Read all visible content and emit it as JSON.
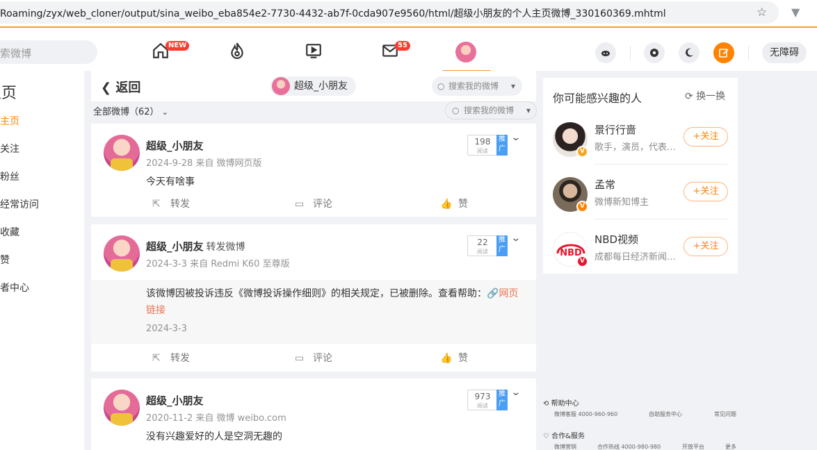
{
  "browser": {
    "url": "Roaming/zyx/web_cloner/output/sina_weibo_eba854e2-7730-4432-ab7f-0cda907e9560/html/超级小朋友的个人主页微博_330160369.mhtml"
  },
  "nav": {
    "search_placeholder": "索微博",
    "home_badge": "NEW",
    "message_badge": "55",
    "accessibility_label": "无障碍"
  },
  "sidebar": {
    "title": "主页",
    "items": [
      {
        "label": "的主页"
      },
      {
        "label": "的关注"
      },
      {
        "label": "的粉丝"
      },
      {
        "label": "的经常访问"
      },
      {
        "label": "的收藏"
      },
      {
        "label": "的赞"
      },
      {
        "label": "作者中心"
      }
    ]
  },
  "header": {
    "back_label": "返回",
    "user_chip": "超级_小朋友",
    "search_placeholder": "搜索我的微博"
  },
  "filter": {
    "all_label": "全部微博（62）",
    "search_placeholder": "搜索我的微博"
  },
  "posts": [
    {
      "author": "超级_小朋友",
      "repost_tag": "",
      "meta": "2024-9-28  来自 微博网页版",
      "text": "今天有啥事",
      "views": "198",
      "views_label": "阅读",
      "promo": "推广"
    },
    {
      "author": "超级_小朋友",
      "repost_tag": "转发微博",
      "meta": "2024-3-3  来自 Redmi K60 至尊版",
      "text": "",
      "quote_text": "该微博因被投诉违反《微博投诉操作细则》的相关规定，已被删除。查看帮助：",
      "quote_link": "网页链接",
      "quote_date": "2024-3-3",
      "views": "22",
      "views_label": "阅读",
      "promo": "推广"
    },
    {
      "author": "超级_小朋友",
      "repost_tag": "",
      "meta": "2020-11-2  来自 微博 weibo.com",
      "text": "没有兴趣爱好的人是空洞无趣的",
      "views": "973",
      "views_label": "阅读",
      "promo": "推广"
    }
  ],
  "actions": {
    "repost": "转发",
    "comment": "评论",
    "like": "赞"
  },
  "recommend": {
    "title": "你可能感兴趣的人",
    "refresh": "换一换",
    "follow_label": "+关注",
    "users": [
      {
        "name": "景行行啬",
        "desc": "歌手，演员，代表作品…",
        "avatar_color": "#e9e4de",
        "badge_color": "#f5a623",
        "badge": "V"
      },
      {
        "name": "孟常",
        "desc": "微博新知博主",
        "avatar_color": "#7a6a5a",
        "badge_color": "#ff8200",
        "badge": "V"
      },
      {
        "name": "NBD视频",
        "desc": "成都每日经济新闻报社…",
        "avatar_color": "#ffffff",
        "badge_color": "#e6162d",
        "badge": "V"
      }
    ]
  },
  "footer": {
    "help_title": "帮助中心",
    "help_links": [
      "微博客服 4000-960-960",
      "自助服务中心",
      "常见问题"
    ],
    "coop_title": "合作&服务",
    "coop_links": [
      "微博营销",
      "合作热线 4000-980-980",
      "开放平台",
      "更多"
    ]
  }
}
